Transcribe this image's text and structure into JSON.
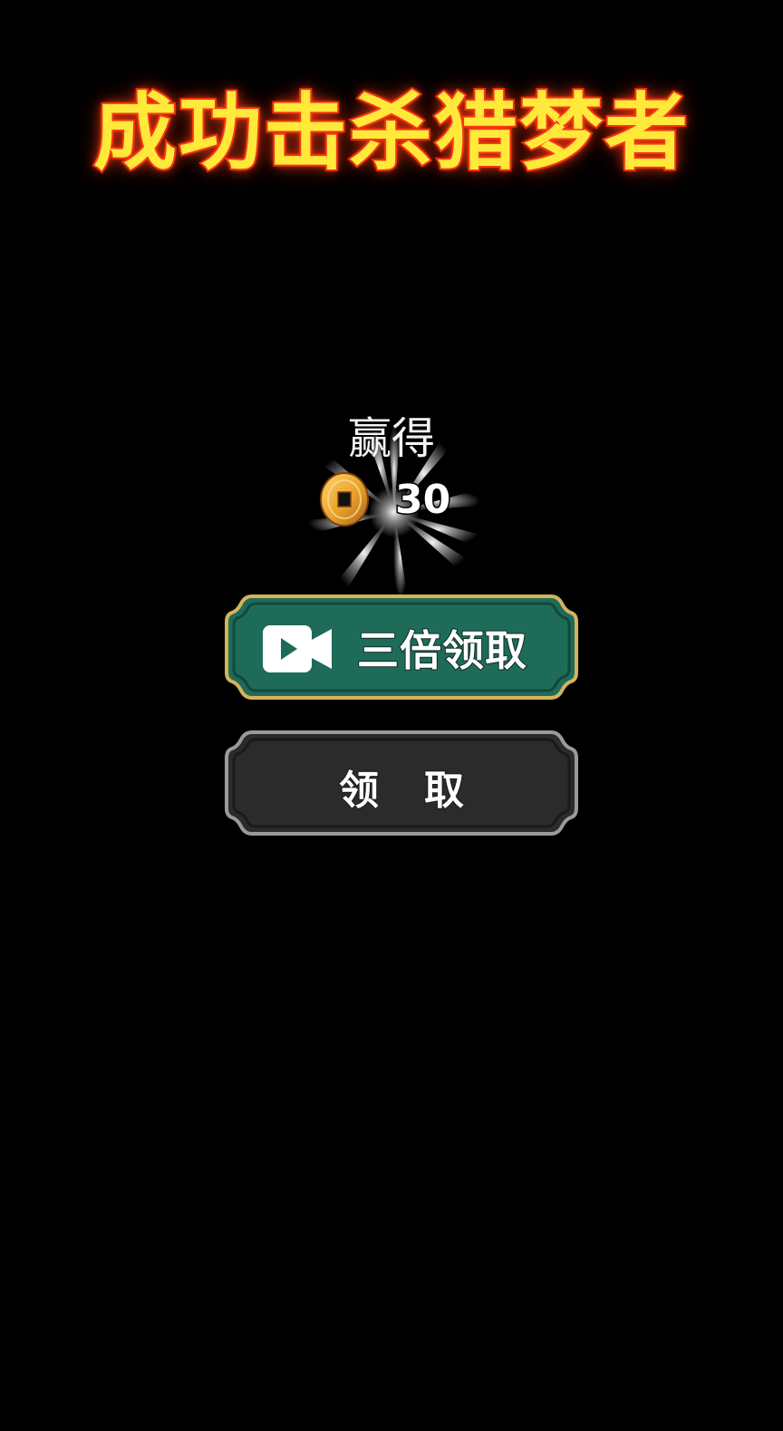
{
  "title": "成功击杀猎梦者",
  "reward": {
    "label": "赢得",
    "currency_icon": "copper-coin-icon",
    "amount": "30"
  },
  "buttons": {
    "triple": {
      "label": "三倍领取",
      "icon": "video-camera-icon",
      "color": "#1f6b59",
      "border_color": "#d7b25c"
    },
    "claim": {
      "label": "领取",
      "color": "#2b2b2b",
      "border_color": "#9a9a9a"
    }
  },
  "colors": {
    "background": "#000000",
    "title_fill": "#ffe93a",
    "title_stroke": "#e22a12",
    "coin": "#e8a12a"
  }
}
